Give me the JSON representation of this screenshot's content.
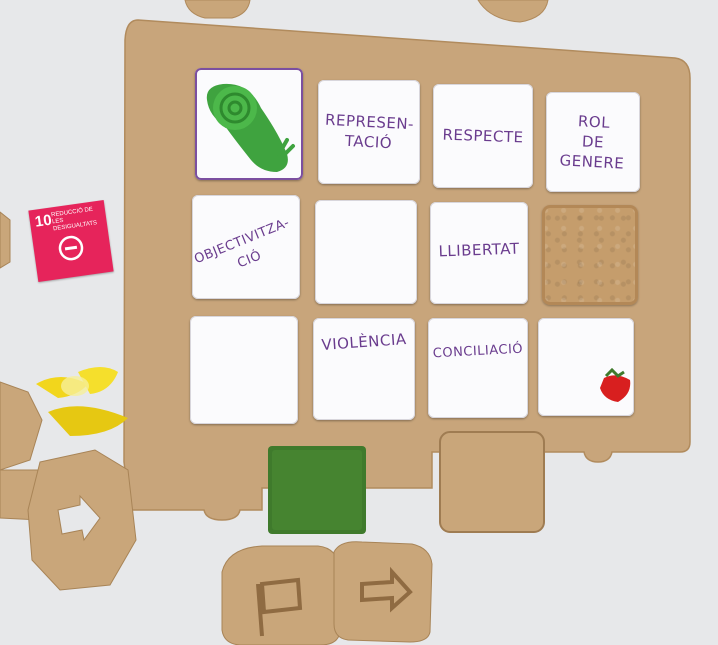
{
  "board": {
    "cells": [
      {
        "id": "r1c1",
        "label": "",
        "content": "green-snail"
      },
      {
        "id": "r1c2",
        "label": "REPRESEN-\nTACIÓ"
      },
      {
        "id": "r1c3",
        "label": "RESPECTE"
      },
      {
        "id": "r1c4",
        "label": "ROL\nDE\nGENERE"
      },
      {
        "id": "r2c1",
        "label": "OBJECTIVITZA-\nCIÓ"
      },
      {
        "id": "r2c2",
        "label": ""
      },
      {
        "id": "r2c3",
        "label": "LLIBERTAT"
      },
      {
        "id": "r2c4",
        "label": "",
        "content": "cork-square"
      },
      {
        "id": "r3c1",
        "label": ""
      },
      {
        "id": "r3c2",
        "label": "VIOLÈNCIA"
      },
      {
        "id": "r3c3",
        "label": "CONCILIACIÓ"
      },
      {
        "id": "r3c4",
        "label": "",
        "content": "red-strawberry"
      }
    ]
  },
  "sdg_card": {
    "number": "10",
    "title": "Reducció de les\ndesigualtats",
    "color": "#e6245b"
  },
  "colors": {
    "board": "#c8a57b",
    "ink": "#6a3c8e",
    "felt": "#3f7a2c",
    "snail": "#3fa33f",
    "butterfly": "#f2d61c",
    "strawberry": "#d81f1f"
  }
}
